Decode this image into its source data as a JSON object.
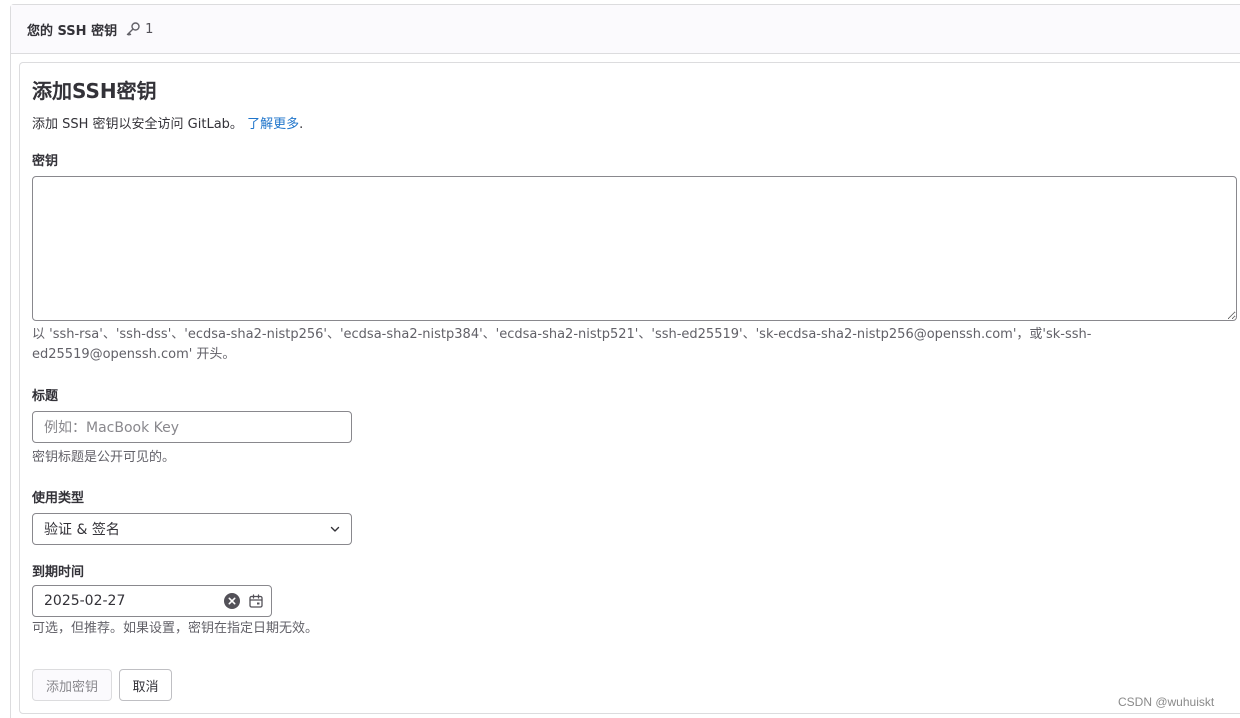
{
  "header": {
    "title": "您的 SSH 密钥",
    "key_count": "1"
  },
  "form": {
    "title": "添加SSH密钥",
    "description": "添加 SSH 密钥以安全访问 GitLab。",
    "learn_more": "了解更多",
    "learn_more_suffix": ".",
    "key_label": "密钥",
    "key_value": "",
    "key_help_line1": "以 'ssh-rsa'、'ssh-dss'、'ecdsa-sha2-nistp256'、'ecdsa-sha2-nistp384'、'ecdsa-sha2-nistp521'、'ssh-ed25519'、'sk-ecdsa-sha2-nistp256@openssh.com'，或'sk-ssh-",
    "key_help_line2": "ed25519@openssh.com' 开头。",
    "title_label": "标题",
    "title_placeholder": "例如：MacBook Key",
    "title_help": "密钥标题是公开可见的。",
    "usage_label": "使用类型",
    "usage_selected": "验证 & 签名",
    "expiry_label": "到期时间",
    "expiry_value": "2025-02-27",
    "expiry_help": "可选，但推荐。如果设置，密钥在指定日期无效。",
    "add_button": "添加密钥",
    "cancel_button": "取消"
  },
  "watermark": "CSDN @wuhuiskt",
  "colors": {
    "link": "#1f75cb",
    "border": "#dcdcde",
    "text": "#333238",
    "muted": "#626168"
  }
}
